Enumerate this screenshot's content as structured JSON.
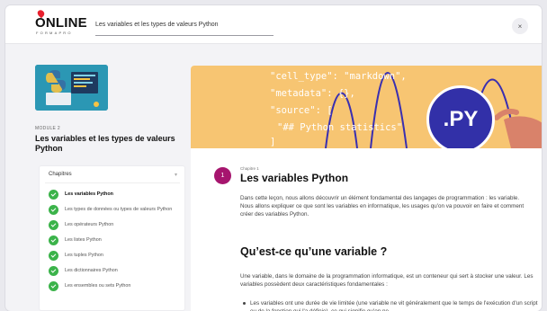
{
  "header": {
    "logo_text": "ONLINE",
    "logo_subtext": "FORMAPRO",
    "title": "Les variables et les types de valeurs Python",
    "close_glyph": "×"
  },
  "sidebar": {
    "module_label": "MODULE 2",
    "module_title": "Les variables et les types de valeurs Python",
    "chapters_heading": "Chapitres",
    "chapters": [
      {
        "label": "Les variables Python",
        "active": true
      },
      {
        "label": "Les types de données ou types de valeurs Python",
        "active": false
      },
      {
        "label": "Les opérateurs Python",
        "active": false
      },
      {
        "label": "Les listes Python",
        "active": false
      },
      {
        "label": "Les tuples Python",
        "active": false
      },
      {
        "label": "Les dictionnaires Python",
        "active": false
      },
      {
        "label": "Les ensembles ou sets Python",
        "active": false
      }
    ]
  },
  "banner": {
    "code_lines": [
      "\"cell_type\": \"markdown\",",
      "\"metadata\": {},",
      "\"source\": [",
      "\"## Python statistics\"",
      "]"
    ],
    "badge_text": ".PY"
  },
  "content": {
    "chapter_number": "1",
    "chapter_kicker": "Chapitre 1",
    "chapter_title": "Les variables Python",
    "intro": "Dans cette leçon, nous allons découvrir un élément fondamental des langages de programmation : les variable. Nous allons expliquer ce que sont les variables en informatique, les usages qu'on va pouvoir en faire et comment créer des variables Python.",
    "section_title": "Qu’est-ce qu’une variable ?",
    "paragraph": "Une variable, dans le domaine de la programmation informatique, est un conteneur qui sert à stocker une valeur. Les variables possèdent deux caractéristiques fondamentales :",
    "bullet": "Les variables ont une durée de vie limitée (une variable ne vit généralement que le temps de l'exécution d'un script ou de la fonction qui l'a définie), ce qui signifie qu'on ne"
  },
  "colors": {
    "check_green": "#3bb34a",
    "badge_magenta": "#a6156e",
    "banner_yellow": "#f7c572",
    "python_blue": "#3230a8"
  }
}
